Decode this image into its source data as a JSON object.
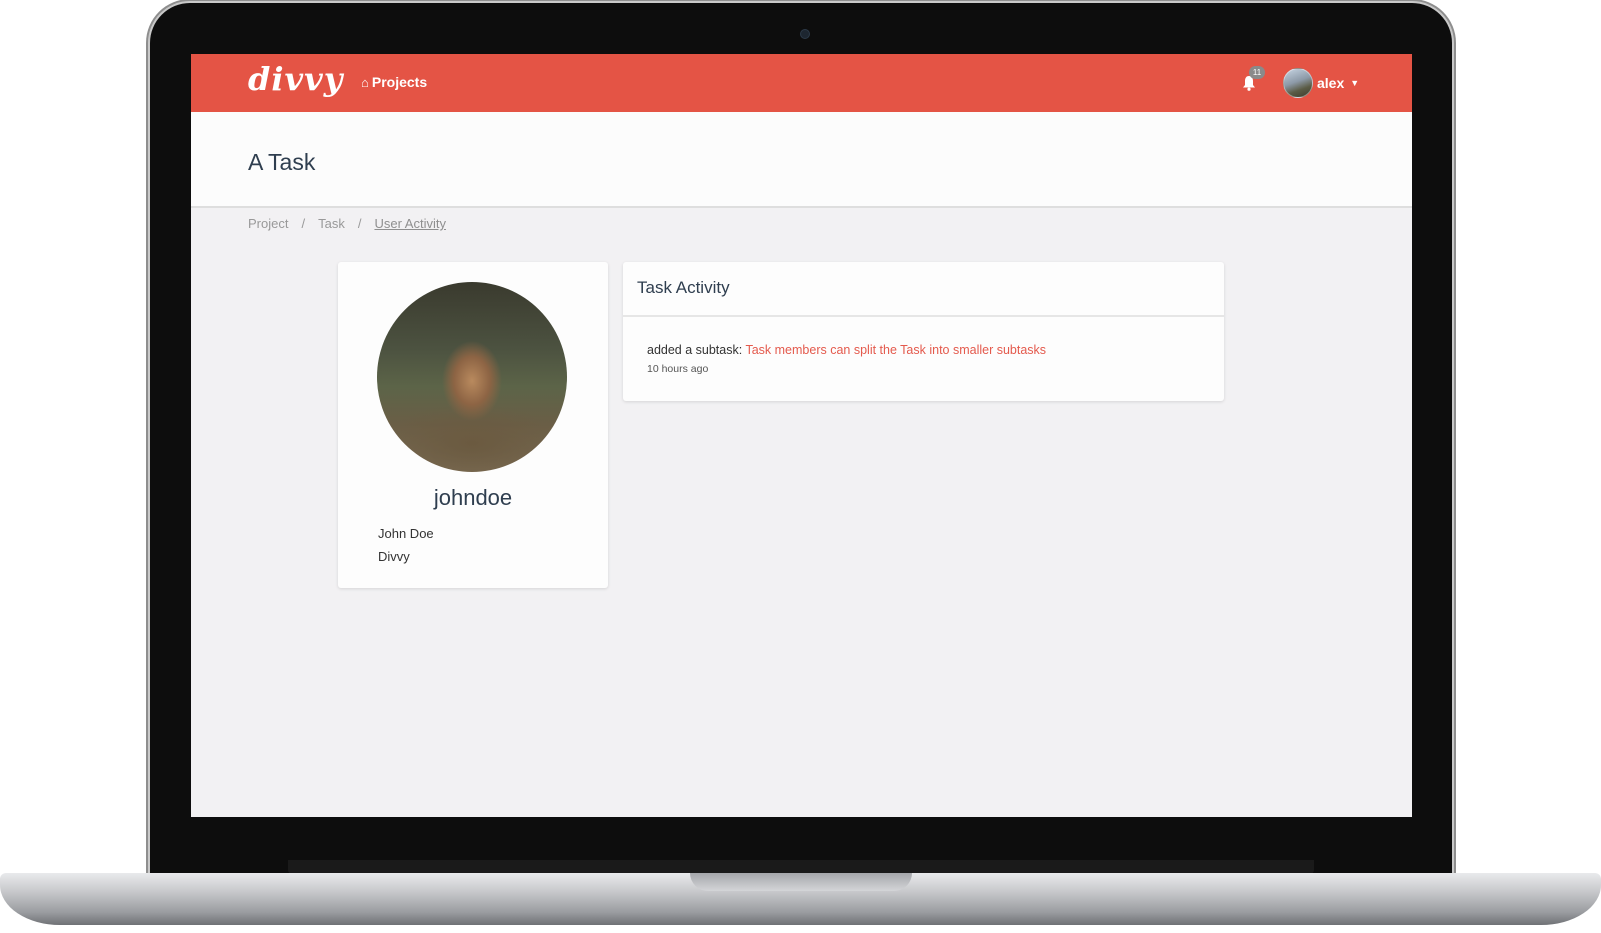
{
  "navbar": {
    "brand": "divvy",
    "projects_label": "Projects",
    "notification_count": "11",
    "user_name": "alex",
    "color": "#e45445"
  },
  "page": {
    "title": "A Task"
  },
  "breadcrumb": {
    "items": [
      "Project",
      "Task",
      "User Activity"
    ],
    "separator": "/"
  },
  "profile": {
    "username": "johndoe",
    "full_name": "John Doe",
    "organization": "Divvy"
  },
  "activity": {
    "title": "Task Activity",
    "items": [
      {
        "action": "added a subtask:",
        "link_text": "Task members can split the Task into smaller subtasks",
        "time": "10 hours ago"
      }
    ]
  }
}
